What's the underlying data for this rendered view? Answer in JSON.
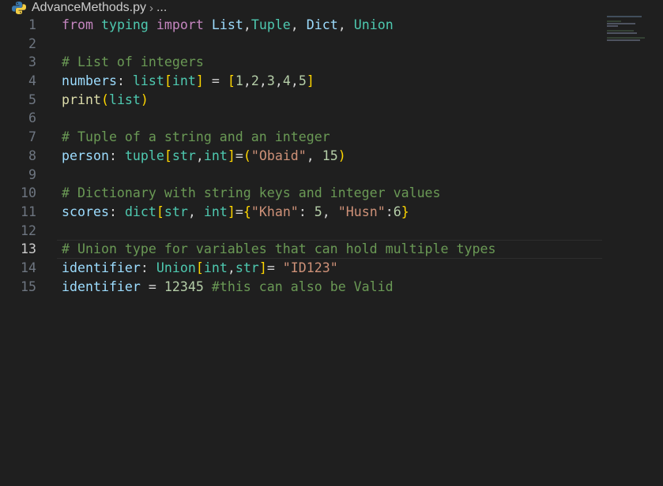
{
  "breadcrumb": {
    "file_name": "AdvanceMethods.py",
    "separator": "›",
    "ellipsis": "..."
  },
  "editor": {
    "current_line": 13,
    "lines": [
      {
        "number": "1",
        "tokens": [
          {
            "t": "from",
            "c": "kw-ctrl"
          },
          {
            "t": " ",
            "c": "op"
          },
          {
            "t": "typing",
            "c": "mod"
          },
          {
            "t": " ",
            "c": "op"
          },
          {
            "t": "import",
            "c": "kw-ctrl"
          },
          {
            "t": " ",
            "c": "op"
          },
          {
            "t": "List",
            "c": "var"
          },
          {
            "t": ",",
            "c": "op"
          },
          {
            "t": "Tuple",
            "c": "type"
          },
          {
            "t": ", ",
            "c": "op"
          },
          {
            "t": "Dict",
            "c": "var"
          },
          {
            "t": ", ",
            "c": "op"
          },
          {
            "t": "Union",
            "c": "type"
          }
        ]
      },
      {
        "number": "2",
        "tokens": []
      },
      {
        "number": "3",
        "tokens": [
          {
            "t": "# List of integers",
            "c": "cmt"
          }
        ]
      },
      {
        "number": "4",
        "tokens": [
          {
            "t": "numbers",
            "c": "var"
          },
          {
            "t": ": ",
            "c": "op"
          },
          {
            "t": "list",
            "c": "type"
          },
          {
            "t": "[",
            "c": "b1"
          },
          {
            "t": "int",
            "c": "type"
          },
          {
            "t": "]",
            "c": "b1"
          },
          {
            "t": " = ",
            "c": "op"
          },
          {
            "t": "[",
            "c": "b1"
          },
          {
            "t": "1",
            "c": "num"
          },
          {
            "t": ",",
            "c": "op"
          },
          {
            "t": "2",
            "c": "num"
          },
          {
            "t": ",",
            "c": "op"
          },
          {
            "t": "3",
            "c": "num"
          },
          {
            "t": ",",
            "c": "op"
          },
          {
            "t": "4",
            "c": "num"
          },
          {
            "t": ",",
            "c": "op"
          },
          {
            "t": "5",
            "c": "num"
          },
          {
            "t": "]",
            "c": "b1"
          }
        ]
      },
      {
        "number": "5",
        "tokens": [
          {
            "t": "print",
            "c": "fn"
          },
          {
            "t": "(",
            "c": "b1"
          },
          {
            "t": "list",
            "c": "type"
          },
          {
            "t": ")",
            "c": "b1"
          }
        ]
      },
      {
        "number": "6",
        "tokens": []
      },
      {
        "number": "7",
        "tokens": [
          {
            "t": "# Tuple of a string and an integer",
            "c": "cmt"
          }
        ]
      },
      {
        "number": "8",
        "tokens": [
          {
            "t": "person",
            "c": "var"
          },
          {
            "t": ": ",
            "c": "op"
          },
          {
            "t": "tuple",
            "c": "type"
          },
          {
            "t": "[",
            "c": "b1"
          },
          {
            "t": "str",
            "c": "type"
          },
          {
            "t": ",",
            "c": "op"
          },
          {
            "t": "int",
            "c": "type"
          },
          {
            "t": "]",
            "c": "b1"
          },
          {
            "t": "=",
            "c": "op"
          },
          {
            "t": "(",
            "c": "b1"
          },
          {
            "t": "\"Obaid\"",
            "c": "str"
          },
          {
            "t": ", ",
            "c": "op"
          },
          {
            "t": "15",
            "c": "num"
          },
          {
            "t": ")",
            "c": "b1"
          }
        ]
      },
      {
        "number": "9",
        "tokens": []
      },
      {
        "number": "10",
        "tokens": [
          {
            "t": "# Dictionary with string keys and integer values",
            "c": "cmt"
          }
        ]
      },
      {
        "number": "11",
        "tokens": [
          {
            "t": "scores",
            "c": "var"
          },
          {
            "t": ": ",
            "c": "op"
          },
          {
            "t": "dict",
            "c": "type"
          },
          {
            "t": "[",
            "c": "b1"
          },
          {
            "t": "str",
            "c": "type"
          },
          {
            "t": ", ",
            "c": "op"
          },
          {
            "t": "int",
            "c": "type"
          },
          {
            "t": "]",
            "c": "b1"
          },
          {
            "t": "=",
            "c": "op"
          },
          {
            "t": "{",
            "c": "b1"
          },
          {
            "t": "\"Khan\"",
            "c": "str"
          },
          {
            "t": ": ",
            "c": "op"
          },
          {
            "t": "5",
            "c": "num"
          },
          {
            "t": ", ",
            "c": "op"
          },
          {
            "t": "\"Husn\"",
            "c": "str"
          },
          {
            "t": ":",
            "c": "op"
          },
          {
            "t": "6",
            "c": "num"
          },
          {
            "t": "}",
            "c": "b1"
          }
        ]
      },
      {
        "number": "12",
        "tokens": []
      },
      {
        "number": "13",
        "tokens": [
          {
            "t": "# Union type for variables that can hold multiple types",
            "c": "cmt"
          }
        ]
      },
      {
        "number": "14",
        "tokens": [
          {
            "t": "identifier",
            "c": "var"
          },
          {
            "t": ": ",
            "c": "op"
          },
          {
            "t": "Union",
            "c": "type"
          },
          {
            "t": "[",
            "c": "b1"
          },
          {
            "t": "int",
            "c": "type"
          },
          {
            "t": ",",
            "c": "op"
          },
          {
            "t": "str",
            "c": "type"
          },
          {
            "t": "]",
            "c": "b1"
          },
          {
            "t": "= ",
            "c": "op"
          },
          {
            "t": "\"ID123\"",
            "c": "str"
          }
        ]
      },
      {
        "number": "15",
        "tokens": [
          {
            "t": "identifier",
            "c": "var"
          },
          {
            "t": " = ",
            "c": "op"
          },
          {
            "t": "12345",
            "c": "num"
          },
          {
            "t": " ",
            "c": "op"
          },
          {
            "t": "#this can also be Valid",
            "c": "cmt"
          }
        ]
      }
    ]
  }
}
